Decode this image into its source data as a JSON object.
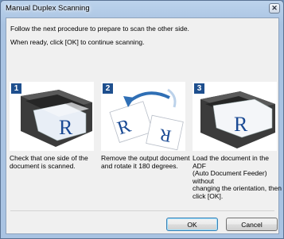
{
  "window": {
    "title": "Manual Duplex Scanning",
    "close_glyph": "✕"
  },
  "instructions": {
    "line1": "Follow the next procedure to prepare to scan the other side.",
    "line2": "When ready, click [OK] to continue scanning."
  },
  "steps": [
    {
      "number": "1",
      "desc_lines": [
        "Check that one side of the",
        "document is scanned."
      ]
    },
    {
      "number": "2",
      "desc_lines": [
        "Remove the output document",
        "and rotate it 180 degrees."
      ]
    },
    {
      "number": "3",
      "desc_lines": [
        "Load the document in the ADF",
        "(Auto Document Feeder) without",
        "changing the orientation, then",
        "click [OK]."
      ]
    }
  ],
  "illustration_letter": "R",
  "buttons": {
    "ok": "OK",
    "cancel": "Cancel"
  },
  "colors": {
    "step_badge": "#1e4f8e",
    "arrow": "#2f6fb5",
    "letter": "#1a4a94"
  }
}
